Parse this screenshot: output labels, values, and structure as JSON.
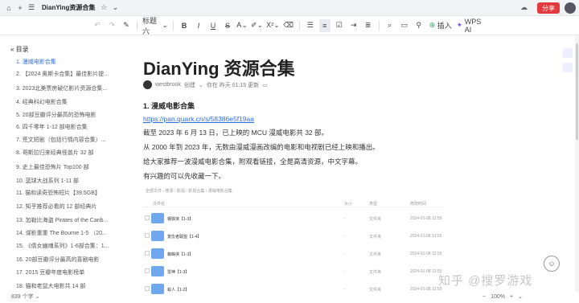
{
  "titlebar": {
    "title": "DianYing资源合集",
    "share_label": "分享"
  },
  "toolbar": {
    "heading_select": "标题六",
    "insert_label": "插入",
    "ai_label": "WPS AI"
  },
  "toc": {
    "title": "目录",
    "items": [
      "1. 漫威电影合集",
      "2. 【2024 奥斯卡合集】最佳影片提...",
      "3. 2023北美票房破亿影片资源合集...",
      "4. 经典科幻电影合集",
      "5. 20部豆瓣评分最高的恐怖电影",
      "6. 四千零年 1-12 部电影合集",
      "7. 荒文短剧（包括行情内容合集）...",
      "8. 哥斯拉归来经典怪兽片 32 部",
      "9. 史上最佳恐怖片 Top100 部",
      "10. 蓝球大战系列 1-11 部",
      "11. 猫和读奇恐怖短片【39.5GB】",
      "12. 知乎推荐必看的 12 部经典片",
      "13. 加勒比海盗 Pirates of the Carib...",
      "14. 谍影重重 The Bourne 1-5 （20...",
      "15. 《倩女幽魂系列》1-6部合集：1...",
      "16. 20部豆瓣评分最高的喜剧电影",
      "17. 2015 豆瓣年度电影榜单",
      "18. 猫和老鼠大电影共 14 部"
    ]
  },
  "doc": {
    "title": "DianYing 资源合集",
    "author": "westbrook",
    "created": "创建",
    "edited": "你在 昨天 01:15 更新",
    "section_title": "1. 漫威电影合集",
    "link": "https://pan.quark.cn/s/58386e5f19aa",
    "paragraphs": [
      "截至 2023 年 6 月 13 日，已上映的 MCU 漫威电影共 32 部。",
      "从 2000 年到 2023 年，无数由漫威漫画改编的电影和电视剧已经上映和播出。",
      "给大家推荐一波漫威电影合集，附观看链接，全是高清资源，中文字幕。",
      "有兴趣的可以先收藏一下。"
    ]
  },
  "filelist": {
    "breadcrumb": "全部文件 › 搜源 › 影视 › 影视合集 › 漫威电影合集",
    "headers": {
      "name": "文件名",
      "size": "大小",
      "type": "类型",
      "time": "修改时间"
    },
    "rows": [
      {
        "name": "钢铁侠【1-3】",
        "size": "-",
        "type": "文件夹",
        "time": "2024-01-08 12:55"
      },
      {
        "name": "复仇者联盟【1-4】",
        "size": "-",
        "type": "文件夹",
        "time": "2024-01-08 12:55"
      },
      {
        "name": "蜘蛛侠【1-3】",
        "size": "-",
        "type": "文件夹",
        "time": "2024-01-08 12:55"
      },
      {
        "name": "雷神【1-3】",
        "size": "-",
        "type": "文件夹",
        "time": "2024-01-08 12:55"
      },
      {
        "name": "蚁人【1-2】",
        "size": "-",
        "type": "文件夹",
        "time": "2024-01-08 12:55"
      }
    ]
  },
  "status": {
    "wordcount": "839 个字",
    "zoom": "100%",
    "watermark": "知乎 @搜罗游戏"
  }
}
